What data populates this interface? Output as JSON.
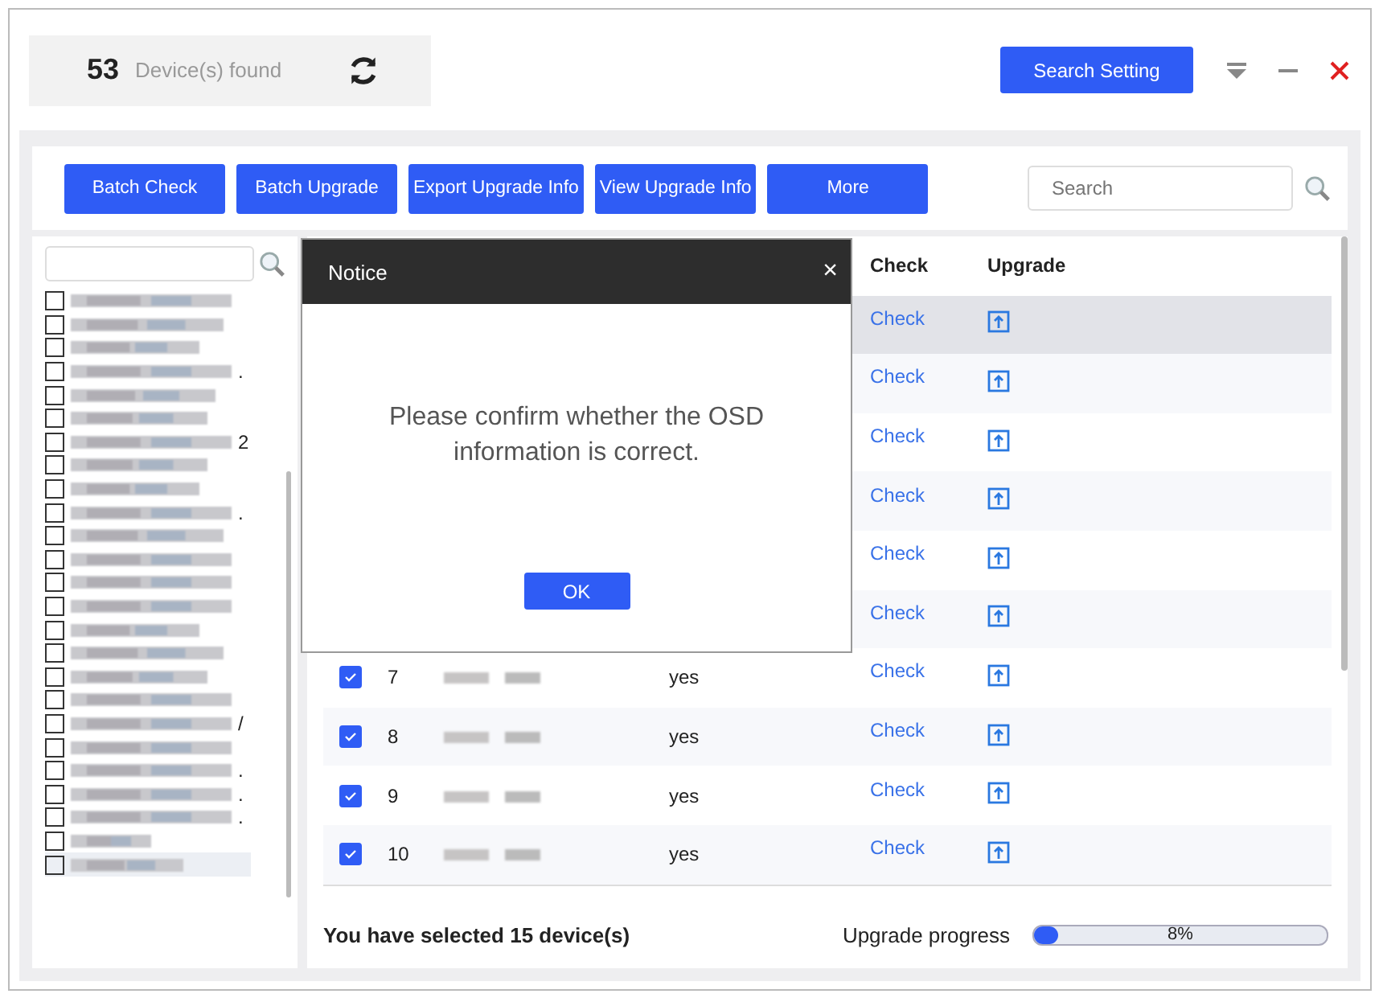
{
  "header": {
    "count": "53",
    "count_label": "Device(s) found",
    "search_setting": "Search Setting"
  },
  "toolbar": {
    "buttons": [
      "Batch Check",
      "Batch Upgrade",
      "Export Upgrade Info",
      "View Upgrade Info",
      "More"
    ],
    "search": {
      "placeholder": "Search"
    }
  },
  "device_tree": {
    "items": [
      {
        "selected": false
      },
      {
        "selected": false
      },
      {
        "selected": false
      },
      {
        "suffix": ".",
        "selected": false
      },
      {
        "selected": false
      },
      {
        "selected": false
      },
      {
        "suffix": "2",
        "selected": false
      },
      {
        "selected": false
      },
      {
        "selected": false
      },
      {
        "suffix": ".",
        "selected": false
      },
      {
        "selected": false
      },
      {
        "selected": false
      },
      {
        "selected": false
      },
      {
        "selected": false
      },
      {
        "selected": false
      },
      {
        "selected": false
      },
      {
        "selected": false
      },
      {
        "selected": false
      },
      {
        "suffix": "/",
        "selected": false
      },
      {
        "selected": false
      },
      {
        "suffix": ".",
        "selected": false
      },
      {
        "suffix": ".",
        "selected": false
      },
      {
        "suffix": ".",
        "selected": false
      },
      {
        "selected": false
      },
      {
        "selected": true
      }
    ]
  },
  "table": {
    "columns": [
      "Check",
      "Upgrade"
    ],
    "rows": [
      {
        "check": "Check",
        "selected": true
      },
      {
        "check": "Check",
        "selected": false
      },
      {
        "check": "Check",
        "selected": false
      },
      {
        "check": "Check",
        "selected": false
      },
      {
        "check": "Check",
        "selected": false
      },
      {
        "check": "Check",
        "selected": false
      },
      {
        "checked": true,
        "no": "7",
        "column_3": "yes",
        "check": "Check",
        "selected": false
      },
      {
        "checked": true,
        "no": "8",
        "column_3": "yes",
        "check": "Check",
        "selected": false
      },
      {
        "checked": true,
        "no": "9",
        "column_3": "yes",
        "check": "Check",
        "selected": false
      },
      {
        "checked": true,
        "no": "10",
        "column_3": "yes",
        "check": "Check",
        "selected": false
      }
    ]
  },
  "footer": {
    "selected_text": "You have selected 15  device(s)",
    "progress_label": "Upgrade progress",
    "level": 0.08,
    "reading": "8%"
  },
  "dialog": {
    "title": "Notice",
    "close": "×",
    "message": "Please confirm whether the OSD information is correct.",
    "ok": "OK"
  }
}
